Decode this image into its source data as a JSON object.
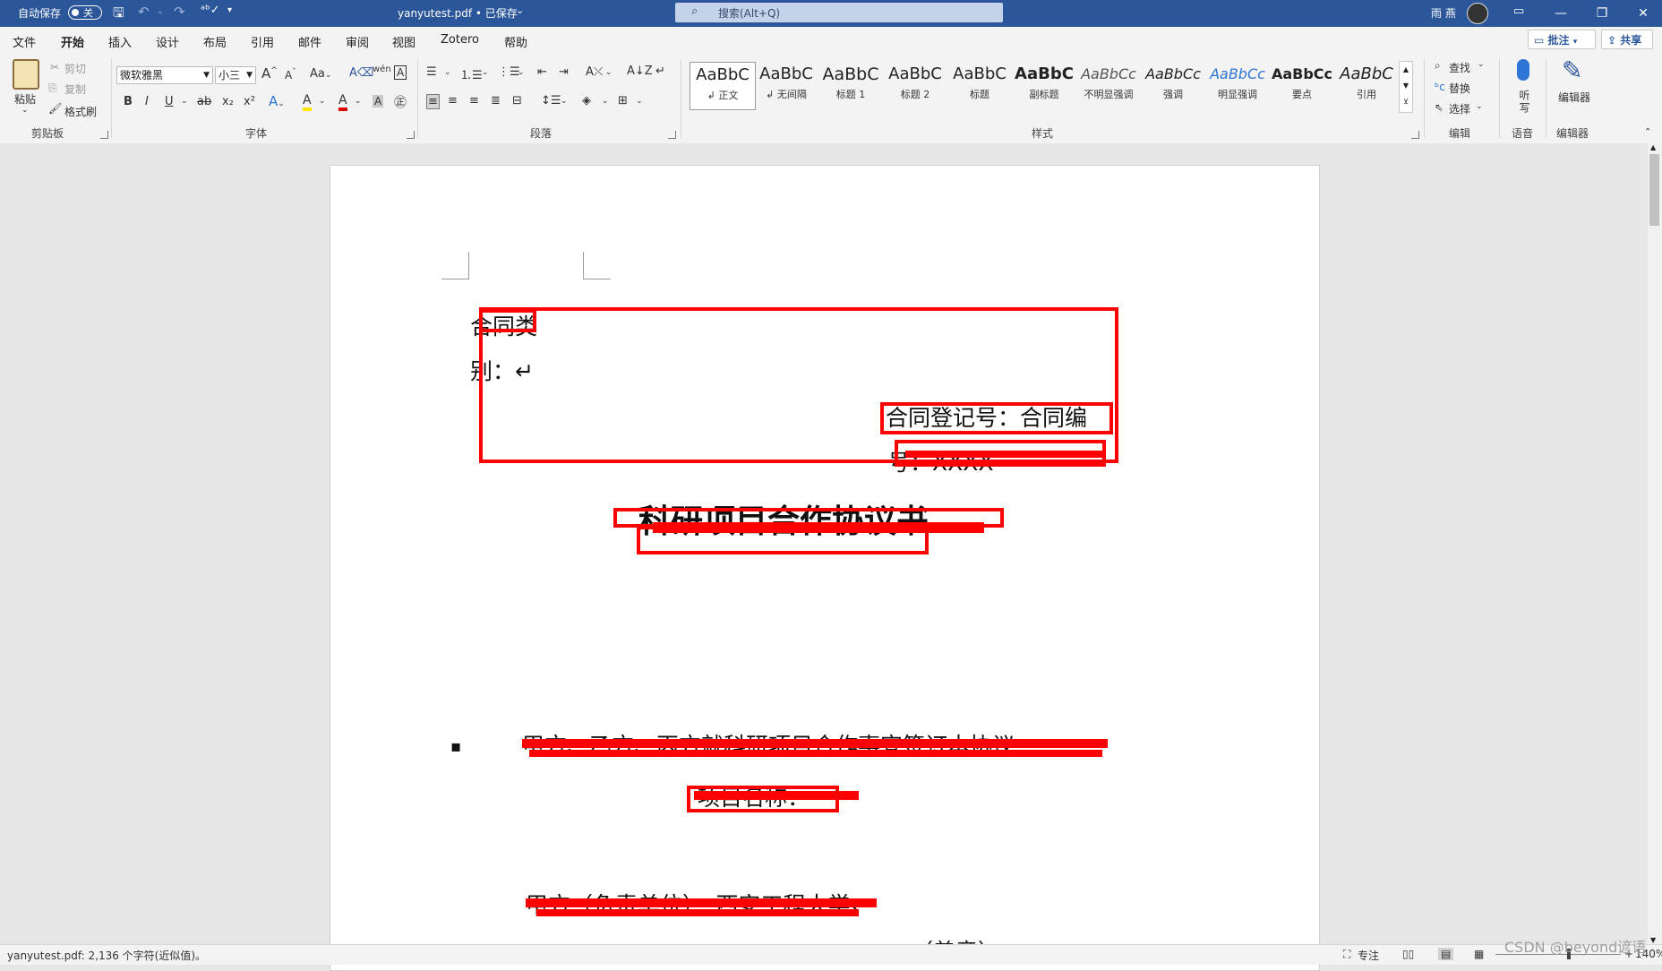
{
  "titlebar": {
    "autosave_label": "自动保存",
    "autosave_state": "关",
    "doc_title": "yanyutest.pdf • 已保存",
    "search_placeholder": "搜索(Alt+Q)",
    "user_name": "雨 燕"
  },
  "tabs": [
    "文件",
    "开始",
    "插入",
    "设计",
    "布局",
    "引用",
    "邮件",
    "审阅",
    "视图",
    "Zotero",
    "帮助"
  ],
  "active_tab": "开始",
  "top_buttons": {
    "comments": "批注",
    "share": "共享"
  },
  "clipboard": {
    "paste": "粘贴",
    "cut": "剪切",
    "copy": "复制",
    "format_painter": "格式刷",
    "group": "剪贴板"
  },
  "font": {
    "name": "微软雅黑",
    "size": "小三",
    "group": "字体",
    "case_btn": "Aa",
    "grow": "A",
    "shrink": "A",
    "bold": "B",
    "italic": "I",
    "underline": "U",
    "strike": "ab",
    "sub": "x₂",
    "sup": "x²",
    "text_effects": "A",
    "highlight": "A",
    "font_color": "A",
    "char_shade": "A",
    "phonetic": "wén",
    "border_char": "A"
  },
  "paragraph": {
    "group": "段落"
  },
  "styles": {
    "group": "样式",
    "items": [
      {
        "preview": "AaBbC",
        "name": "↲ 正文"
      },
      {
        "preview": "AaBbC",
        "name": "↲ 无间隔"
      },
      {
        "preview": "AaBbC",
        "name": "标题 1"
      },
      {
        "preview": "AaBbC",
        "name": "标题 2"
      },
      {
        "preview": "AaBbC",
        "name": "标题"
      },
      {
        "preview": "AaBbC",
        "name": "副标题"
      },
      {
        "preview": "AaBbCc",
        "name": "不明显强调"
      },
      {
        "preview": "AaBbCc",
        "name": "强调"
      },
      {
        "preview": "AaBbCc",
        "name": "明显强调"
      },
      {
        "preview": "AaBbCc",
        "name": "要点"
      },
      {
        "preview": "AaBbC",
        "name": "引用"
      }
    ]
  },
  "editing": {
    "find": "查找",
    "replace": "替换",
    "select": "选择",
    "group": "编辑"
  },
  "voice": {
    "dictate": "听写",
    "group": "语音"
  },
  "editor": {
    "label": "编辑器",
    "group": "编辑器"
  },
  "document": {
    "line1": "合同类",
    "line2": "别：↵",
    "line3": "合同登记号：合同编",
    "line4": "号：XXXX-",
    "title": "科研项目合作协议书",
    "clause": "甲方、乙方、丙方就科研项目合作事宜签订本协议",
    "sub": "项目名称：",
    "partyA": "甲方（负责单位）：西安工程大学↵",
    "seal": "（盖章）↵"
  },
  "status": {
    "left": "yanyutest.pdf: 2,136 个字符(近似值)。",
    "focus": "专注",
    "zoom": "140%"
  },
  "watermark": "CSDN @beyond谚语"
}
